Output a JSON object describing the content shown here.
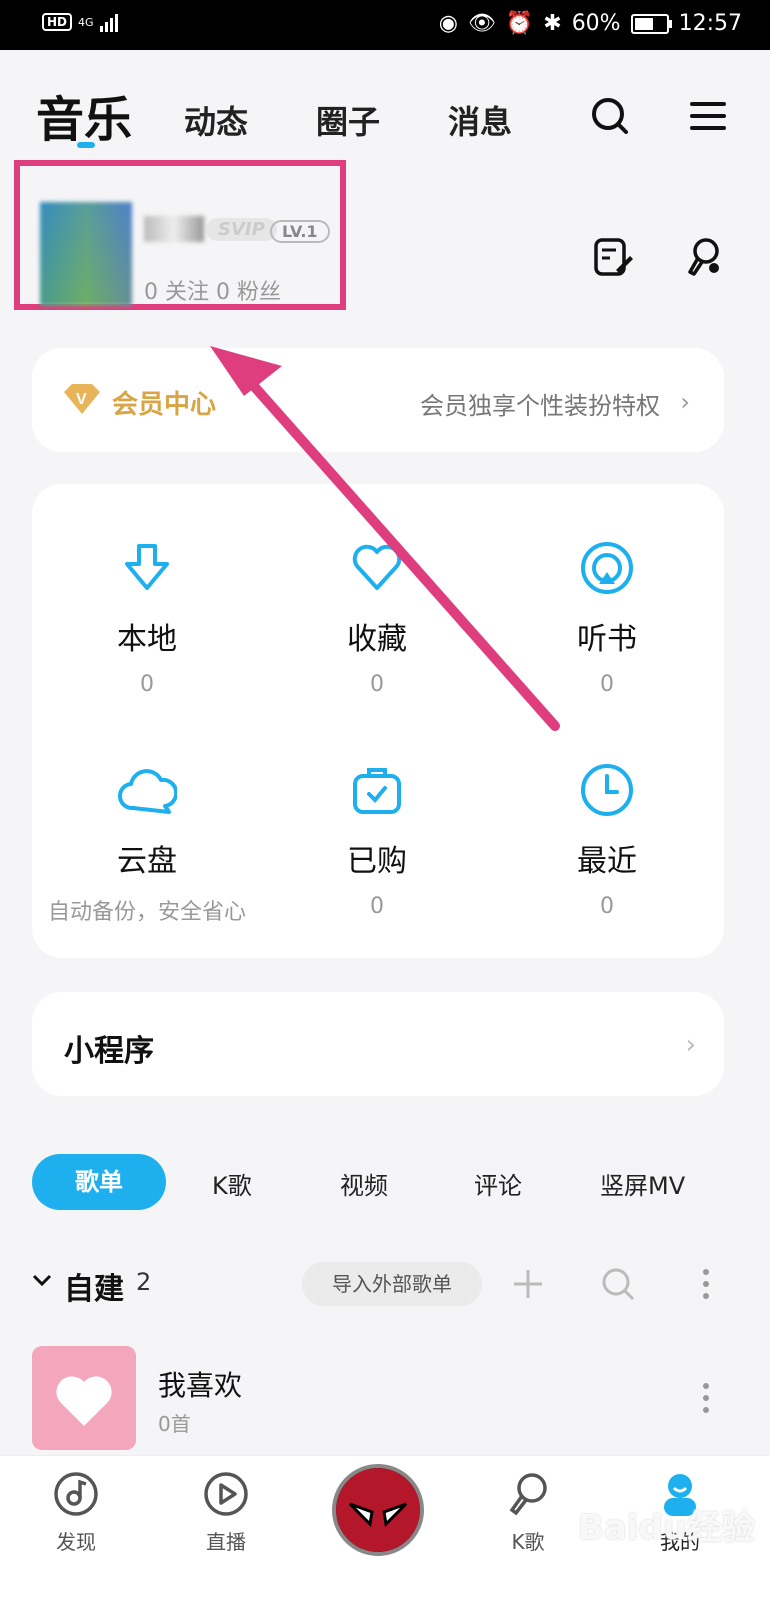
{
  "status_bar": {
    "hd": "HD",
    "network": "4G",
    "battery": "60%",
    "time": "12:57"
  },
  "top_nav": {
    "active_tab": "音乐",
    "tabs": [
      "动态",
      "圈子",
      "消息"
    ]
  },
  "profile": {
    "badge_svip": "SVIP",
    "level": "LV.1",
    "follow_text": "0 关注    0 粉丝"
  },
  "vip": {
    "title": "会员中心",
    "desc": "会员独享个性装扮特权",
    "accent": "#d9a444"
  },
  "grid": [
    {
      "icon": "download-icon",
      "label": "本地",
      "count": "0"
    },
    {
      "icon": "heart-icon",
      "label": "收藏",
      "count": "0"
    },
    {
      "icon": "podcast-icon",
      "label": "听书",
      "count": "0"
    },
    {
      "icon": "cloud-icon",
      "label": "云盘",
      "count": "自动备份，安全省心"
    },
    {
      "icon": "bag-check-icon",
      "label": "已购",
      "count": "0"
    },
    {
      "icon": "clock-icon",
      "label": "最近",
      "count": "0"
    }
  ],
  "mini_program": {
    "title": "小程序"
  },
  "filter_tabs": {
    "active": "歌单",
    "tabs": [
      "K歌",
      "视频",
      "评论",
      "竖屏MV"
    ]
  },
  "section": {
    "title": "自建",
    "count": "2",
    "import_label": "导入外部歌单"
  },
  "playlist": {
    "title": "我喜欢",
    "subtitle": "0首"
  },
  "bottom_nav": [
    {
      "label": "发现"
    },
    {
      "label": "直播"
    },
    {
      "label": "K歌"
    },
    {
      "label": "我的"
    }
  ],
  "watermark": "Baidu经验",
  "colors": {
    "accent": "#1eb0ee",
    "highlight": "#de3d7e",
    "gold": "#d9a444"
  }
}
